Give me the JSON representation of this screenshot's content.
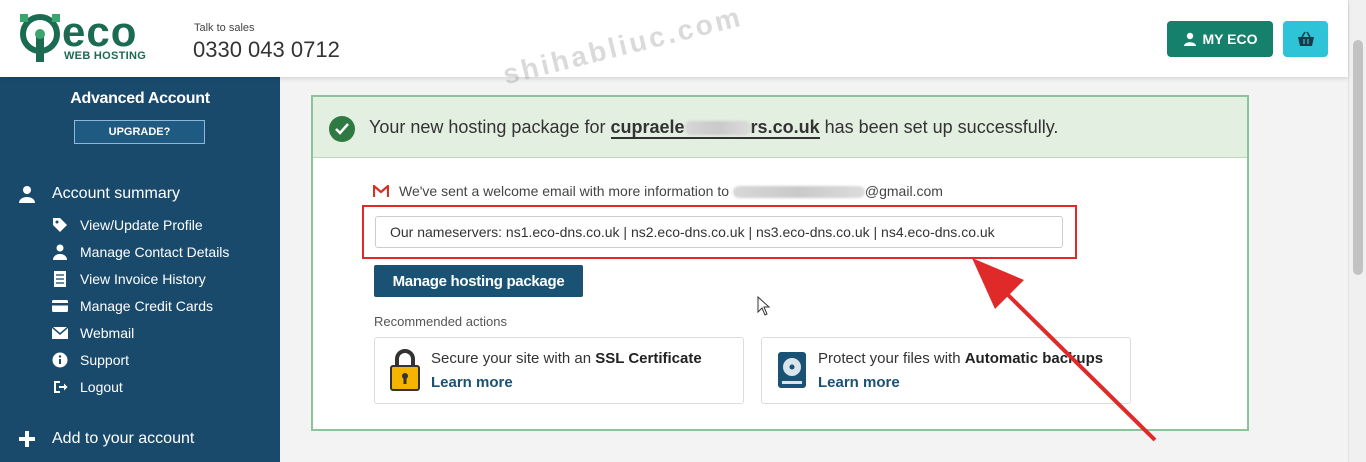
{
  "header": {
    "logo_word": "eco",
    "logo_sub": "WEB HOSTING",
    "sales_label": "Talk to sales",
    "sales_phone": "0330 043 0712",
    "my_eco_label": "MY ECO",
    "watermark": "shihabliuc.com"
  },
  "sidebar": {
    "account_type": "Advanced Account",
    "upgrade_label": "UPGRADE?",
    "summary_label": "Account summary",
    "items": [
      {
        "label": "View/Update Profile",
        "icon": "tag-icon"
      },
      {
        "label": "Manage Contact Details",
        "icon": "person-icon"
      },
      {
        "label": "View Invoice History",
        "icon": "invoice-icon"
      },
      {
        "label": "Manage Credit Cards",
        "icon": "credit-card-icon"
      },
      {
        "label": "Webmail",
        "icon": "envelope-icon"
      },
      {
        "label": "Support",
        "icon": "info-icon"
      },
      {
        "label": "Logout",
        "icon": "logout-icon"
      }
    ],
    "add_label": "Add to your account"
  },
  "main": {
    "success_prefix": "Your new hosting package for ",
    "success_domain_start": "cupraele",
    "success_domain_end": "rs.co.uk",
    "success_suffix": " has been set up successfully.",
    "mail_prefix": "We've sent a welcome email with more information to ",
    "mail_suffix": "@gmail.com",
    "nameservers": "Our nameservers: ns1.eco-dns.co.uk | ns2.eco-dns.co.uk | ns3.eco-dns.co.uk | ns4.eco-dns.co.uk",
    "manage_label": "Manage hosting package",
    "recommended_label": "Recommended actions",
    "ssl_text": "Secure your site with an ",
    "ssl_bold": "SSL Certificate",
    "backup_text": "Protect your files with ",
    "backup_bold": "Automatic backups",
    "learn_more": "Learn more"
  },
  "colors": {
    "brand_green": "#1a6b52",
    "sidebar_blue": "#1a4a6b",
    "success_bg": "#e3efe0",
    "highlight_red": "#e02a2a",
    "cart_cyan": "#2ec3d6"
  }
}
